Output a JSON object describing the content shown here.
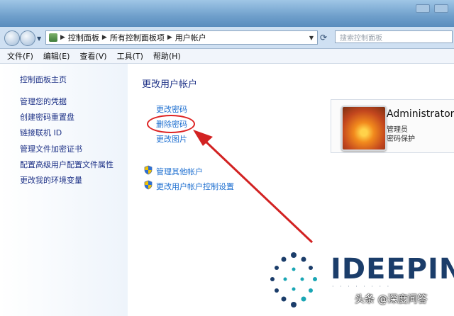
{
  "address": {
    "crumbs": [
      "控制面板",
      "所有控制面板项",
      "用户帐户"
    ],
    "search_placeholder": "搜索控制面板"
  },
  "menu": [
    "文件(F)",
    "编辑(E)",
    "查看(V)",
    "工具(T)",
    "帮助(H)"
  ],
  "sidebar": {
    "home": "控制面板主页",
    "items": [
      "管理您的凭据",
      "创建密码重置盘",
      "链接联机 ID",
      "管理文件加密证书",
      "配置高级用户配置文件属性",
      "更改我的环境变量"
    ]
  },
  "main": {
    "title": "更改用户帐户",
    "tasks": [
      "更改密码",
      "删除密码",
      "更改图片"
    ],
    "admin_tasks": [
      "管理其他帐户",
      "更改用户帐户控制设置"
    ]
  },
  "user": {
    "name": "Administrator",
    "role": "管理员",
    "protection": "密码保护"
  },
  "watermark": {
    "brand": "IDEEPIN",
    "footer": "头条 @深度问答"
  },
  "colors": {
    "link": "#1e6fd0",
    "annotation": "#d22222",
    "titlebar": "#6f9fcb"
  }
}
